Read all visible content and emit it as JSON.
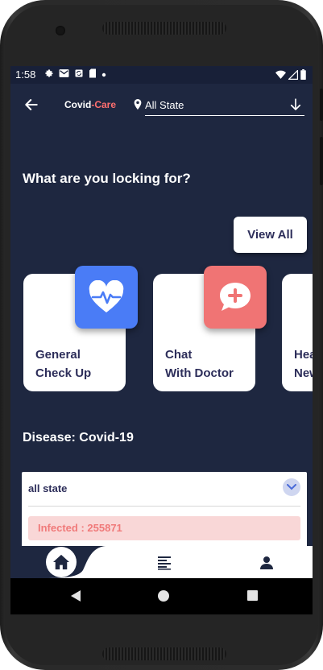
{
  "status_bar": {
    "time": "1:58",
    "left_icons": [
      "gear-icon",
      "mail-icon",
      "sync-icon",
      "sd-card-icon",
      "dot-icon"
    ],
    "right_icons": [
      "wifi-icon",
      "signal-icon",
      "battery-icon"
    ]
  },
  "app_bar": {
    "brand_main": "Covid",
    "brand_accent": "-Care",
    "state_selector_label": "All State"
  },
  "main": {
    "heading": "What are you locking for?",
    "view_all_label": "View All",
    "cards": [
      {
        "label": "General\nCheck Up",
        "icon": "heart-pulse-icon",
        "icon_color": "#4a7cf6"
      },
      {
        "label": "Chat\nWith Doctor",
        "icon": "chat-plus-icon",
        "icon_color": "#f07474"
      },
      {
        "label": "Hea\nNew",
        "icon": "",
        "icon_color": ""
      }
    ],
    "disease_title": "Disease: Covid-19",
    "panel": {
      "state_value": "all state",
      "infected_text": "Infected : 255871"
    }
  },
  "bottom_nav": {
    "items": [
      "home-icon",
      "list-icon",
      "profile-icon"
    ]
  },
  "colors": {
    "background": "#1e2740",
    "brand_accent": "#ff6f6f",
    "text_dark": "#2d2e5a",
    "infected_bg": "#f9d7d7",
    "infected_text": "#f07a7a"
  }
}
